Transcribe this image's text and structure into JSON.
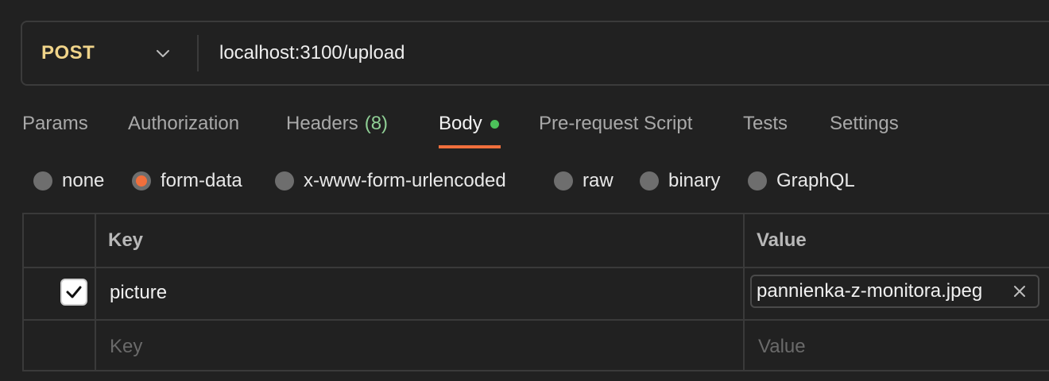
{
  "request": {
    "method": "POST",
    "url": "localhost:3100/upload"
  },
  "tabs": [
    {
      "label": "Params"
    },
    {
      "label": "Authorization"
    },
    {
      "label": "Headers",
      "count": "(8)"
    },
    {
      "label": "Body"
    },
    {
      "label": "Pre-request Script"
    },
    {
      "label": "Tests"
    },
    {
      "label": "Settings"
    }
  ],
  "active_tab": "Body",
  "body_types": [
    {
      "label": "none",
      "selected": false
    },
    {
      "label": "form-data",
      "selected": true
    },
    {
      "label": "x-www-form-urlencoded",
      "selected": false
    },
    {
      "label": "raw",
      "selected": false
    },
    {
      "label": "binary",
      "selected": false
    },
    {
      "label": "GraphQL",
      "selected": false
    }
  ],
  "table": {
    "headers": {
      "key": "Key",
      "value": "Value"
    },
    "rows": [
      {
        "checked": true,
        "key": "picture",
        "value": "pannienka-z-monitora.jpeg"
      }
    ],
    "new_row": {
      "key_placeholder": "Key",
      "value_placeholder": "Value"
    }
  },
  "colors": {
    "accent": "#f16f3c",
    "method": "#f0d48a",
    "status_dot": "#4cc15a",
    "count": "#8fcf95"
  },
  "icons": {
    "method_dropdown": "chevron-down-icon",
    "checkbox": "checkmark-icon",
    "remove_file": "close-icon"
  }
}
